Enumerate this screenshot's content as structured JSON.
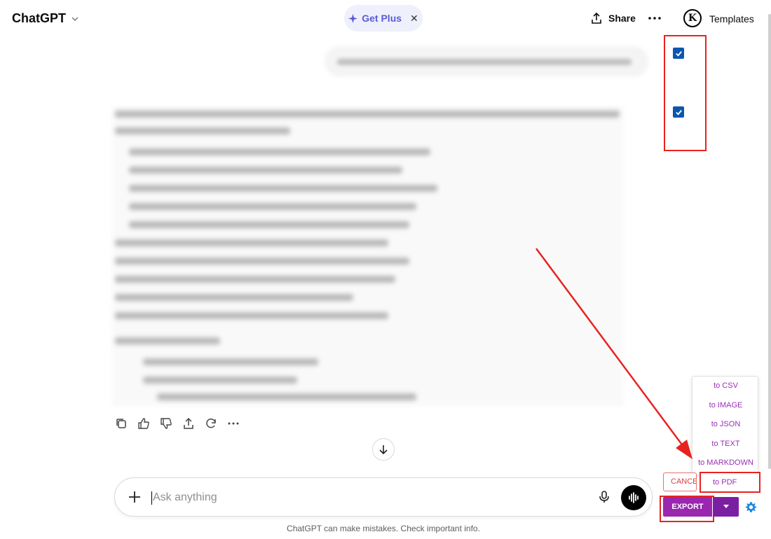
{
  "header": {
    "app_title": "ChatGPT",
    "get_plus_label": "Get Plus",
    "share_label": "Share",
    "logo_letter": "K",
    "templates_label": "Templates"
  },
  "composer": {
    "placeholder": "Ask anything"
  },
  "disclaimer": "ChatGPT can make mistakes. Check important info.",
  "export": {
    "menu_items": [
      "to CSV",
      "to IMAGE",
      "to JSON",
      "to TEXT",
      "to MARKDOWN",
      "to PDF"
    ],
    "cancel_label": "CANCEL",
    "export_label": "EXPORT"
  },
  "checkboxes": [
    {
      "checked": true
    },
    {
      "checked": true
    }
  ],
  "colors": {
    "accent_purple": "#9b27b0",
    "accent_purple_dark": "#7b1fa2",
    "menu_text": "#9a2eb8",
    "checkbox_blue": "#0b57b0",
    "highlight_red": "#e8231f",
    "plus_text": "#5b5bd6"
  }
}
